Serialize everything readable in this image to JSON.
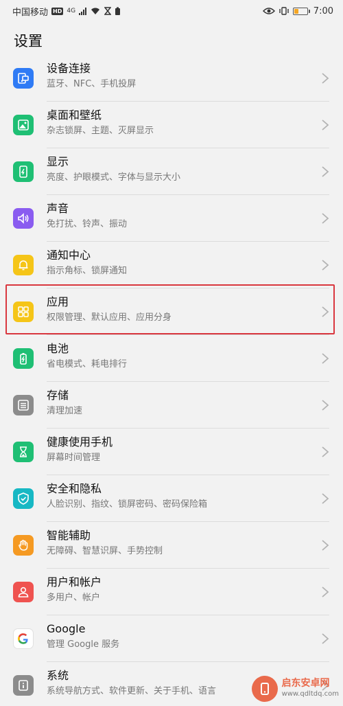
{
  "status_bar": {
    "carrier": "中国移动",
    "hd_badge": "HD",
    "network": "4G",
    "time": "7:00"
  },
  "header": {
    "title": "设置"
  },
  "items": [
    {
      "title": "设备连接",
      "subtitle": "蓝牙、NFC、手机投屏",
      "icon": "device-connect-icon",
      "color": "#2f7bf5"
    },
    {
      "title": "桌面和壁纸",
      "subtitle": "杂志锁屏、主题、灭屏显示",
      "icon": "wallpaper-icon",
      "color": "#1fbf74"
    },
    {
      "title": "显示",
      "subtitle": "亮度、护眼模式、字体与显示大小",
      "icon": "display-icon",
      "color": "#1fbf74"
    },
    {
      "title": "声音",
      "subtitle": "免打扰、铃声、振动",
      "icon": "sound-icon",
      "color": "#8a5cf0"
    },
    {
      "title": "通知中心",
      "subtitle": "指示角标、锁屏通知",
      "icon": "bell-icon",
      "color": "#f5c518"
    },
    {
      "title": "应用",
      "subtitle": "权限管理、默认应用、应用分身",
      "icon": "apps-grid-icon",
      "color": "#f5c518"
    },
    {
      "title": "电池",
      "subtitle": "省电模式、耗电排行",
      "icon": "battery-icon",
      "color": "#1fbf74"
    },
    {
      "title": "存储",
      "subtitle": "清理加速",
      "icon": "storage-icon",
      "color": "#8c8c8c"
    },
    {
      "title": "健康使用手机",
      "subtitle": "屏幕时间管理",
      "icon": "hourglass-icon",
      "color": "#1fbf74"
    },
    {
      "title": "安全和隐私",
      "subtitle": "人脸识别、指纹、锁屏密码、密码保险箱",
      "icon": "shield-icon",
      "color": "#17b8c4"
    },
    {
      "title": "智能辅助",
      "subtitle": "无障碍、智慧识屏、手势控制",
      "icon": "hand-icon",
      "color": "#f59a23"
    },
    {
      "title": "用户和帐户",
      "subtitle": "多用户、帐户",
      "icon": "user-icon",
      "color": "#ef5350"
    },
    {
      "title": "Google",
      "subtitle": "管理 Google 服务",
      "icon": "google-icon",
      "color": "#ffffff"
    },
    {
      "title": "系统",
      "subtitle": "系统导航方式、软件更新、关于手机、语言",
      "icon": "system-info-icon",
      "color": "#8c8c8c"
    }
  ],
  "watermark": {
    "name": "启东安卓网",
    "url": "www.qdltdq.com"
  }
}
